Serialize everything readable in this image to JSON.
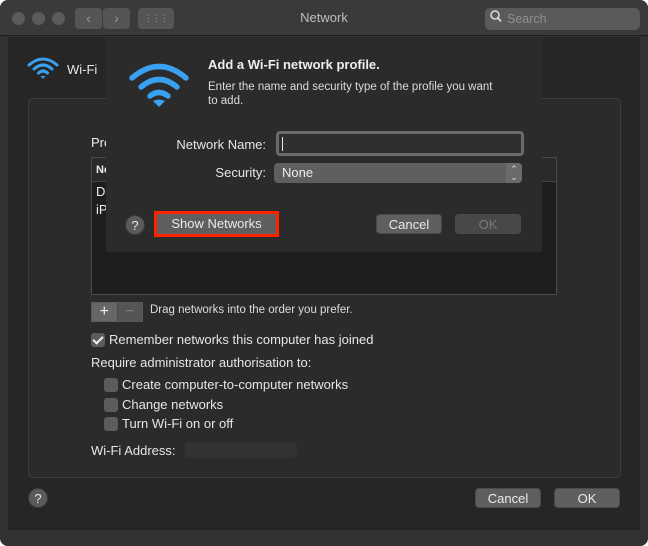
{
  "window": {
    "title": "Network",
    "search_placeholder": "Search",
    "nav_back": "‹",
    "nav_forward": "›",
    "grid_icon": "⋮⋮⋮"
  },
  "sidebar": {
    "interface_name": "Wi-Fi",
    "interface_icon": "wifi-icon"
  },
  "panel": {
    "preferred_label_partial": "Pre",
    "list_header_partial": "Ne",
    "list_items_partial": [
      "Di",
      "iP"
    ],
    "add_label": "+",
    "remove_label": "−",
    "drag_hint": "Drag networks into the order you prefer.",
    "remember_networks": {
      "label": "Remember networks this computer has joined",
      "checked": true
    },
    "require_admin_label": "Require administrator authorisation to:",
    "admin_options": [
      {
        "label": "Create computer-to-computer networks",
        "checked": false
      },
      {
        "label": "Change networks",
        "checked": false
      },
      {
        "label": "Turn Wi-Fi on or off",
        "checked": false
      }
    ],
    "wifi_address_label": "Wi-Fi Address:"
  },
  "footer": {
    "help": "?",
    "cancel": "Cancel",
    "ok": "OK"
  },
  "sheet": {
    "icon": "wifi-icon",
    "title": "Add a Wi-Fi network profile.",
    "description": "Enter the name and security type of the profile you want to add.",
    "network_name_label": "Network Name:",
    "network_name_value": "",
    "security_label": "Security:",
    "security_value": "None",
    "help": "?",
    "show_networks": "Show Networks",
    "cancel": "Cancel",
    "ok": "OK",
    "highlight_color": "#ff2200"
  },
  "colors": {
    "accent_wifi": "#3aa0f0"
  }
}
